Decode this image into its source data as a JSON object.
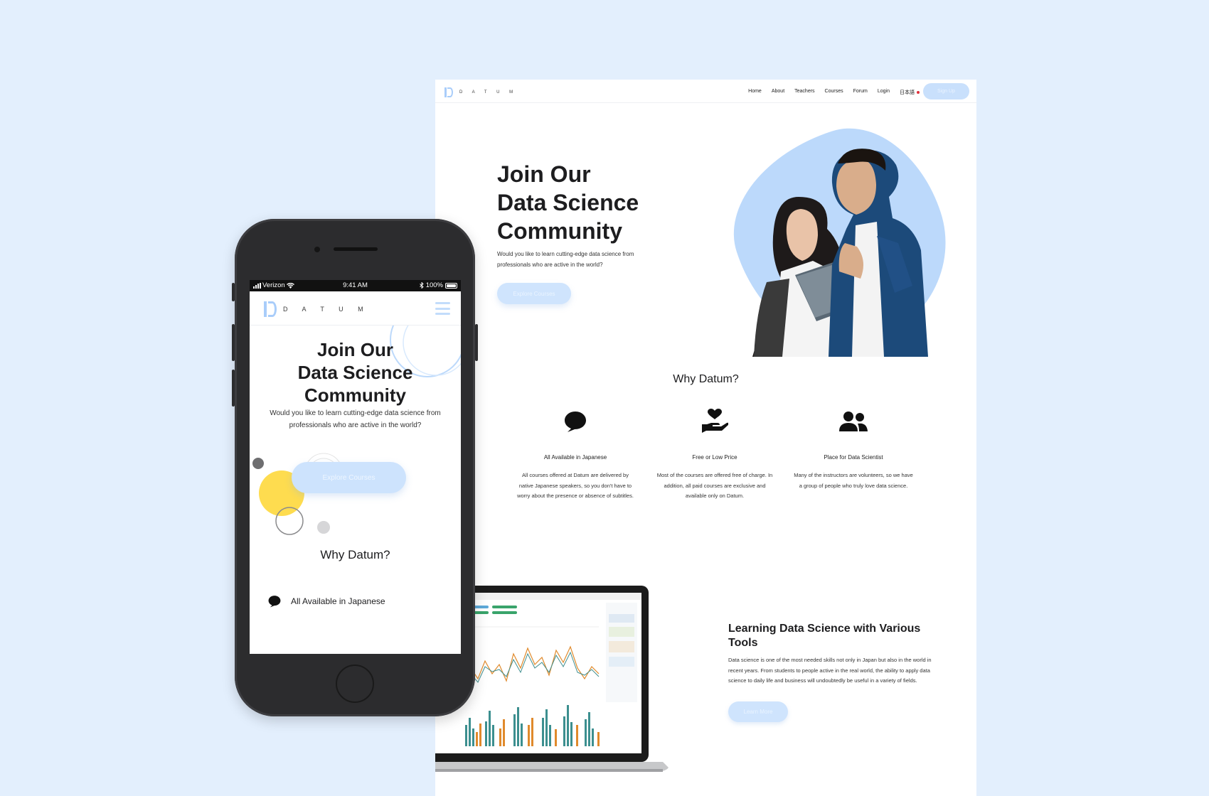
{
  "desktop": {
    "brand": "D A T U M",
    "nav": {
      "items": [
        "Home",
        "About",
        "Teachers",
        "Courses",
        "Forum",
        "Login"
      ],
      "language": "日本語",
      "signup_label": "Sign Up"
    },
    "hero": {
      "title_lines": [
        "Join Our",
        "Data Science",
        "Community"
      ],
      "subtitle": "Would you like to learn cutting-edge data science from professionals who are active in the world?",
      "cta_label": "Explore Courses"
    },
    "why": {
      "title": "Why Datum?",
      "features": [
        {
          "icon": "speech-bubble-icon",
          "title": "All Available in Japanese",
          "desc": "All courses offered at Datum are delivered by native Japanese speakers, so you don't have to worry about the presence or absence of subtitles."
        },
        {
          "icon": "heart-hand-icon",
          "title": "Free or Low Price",
          "desc": "Most of the courses are offered free of charge. In addition, all paid courses are exclusive and available only on Datum."
        },
        {
          "icon": "people-icon",
          "title": "Place for Data Scientist",
          "desc": "Many of the instructors are volunteers, so we have a group of people who truly love data science."
        }
      ]
    },
    "tools": {
      "title": "Learning Data Science with Various Tools",
      "desc": "Data science is one of the most needed skills not only in Japan but also in the world in recent years. From students to people active in the real world, the ability to apply data science to daily life and business will undoubtedly be useful in a variety of fields.",
      "cta_label": "Learn More"
    }
  },
  "mobile": {
    "status": {
      "carrier": "Verizon",
      "time": "9:41 AM",
      "battery": "100%"
    },
    "brand": "D A T U M",
    "hero": {
      "title_lines": [
        "Join Our",
        "Data Science",
        "Community"
      ],
      "subtitle": "Would you like to learn cutting-edge data science from professionals who are active in the world?",
      "cta_label": "Explore Courses"
    },
    "why_title": "Why Datum?",
    "first_feature": "All Available in Japanese"
  },
  "colors": {
    "background": "#e3effd",
    "accent": "#bcd9fb",
    "button": "#cfe4fd",
    "yellow": "#fedc4f",
    "text": "#1d1d1f"
  }
}
